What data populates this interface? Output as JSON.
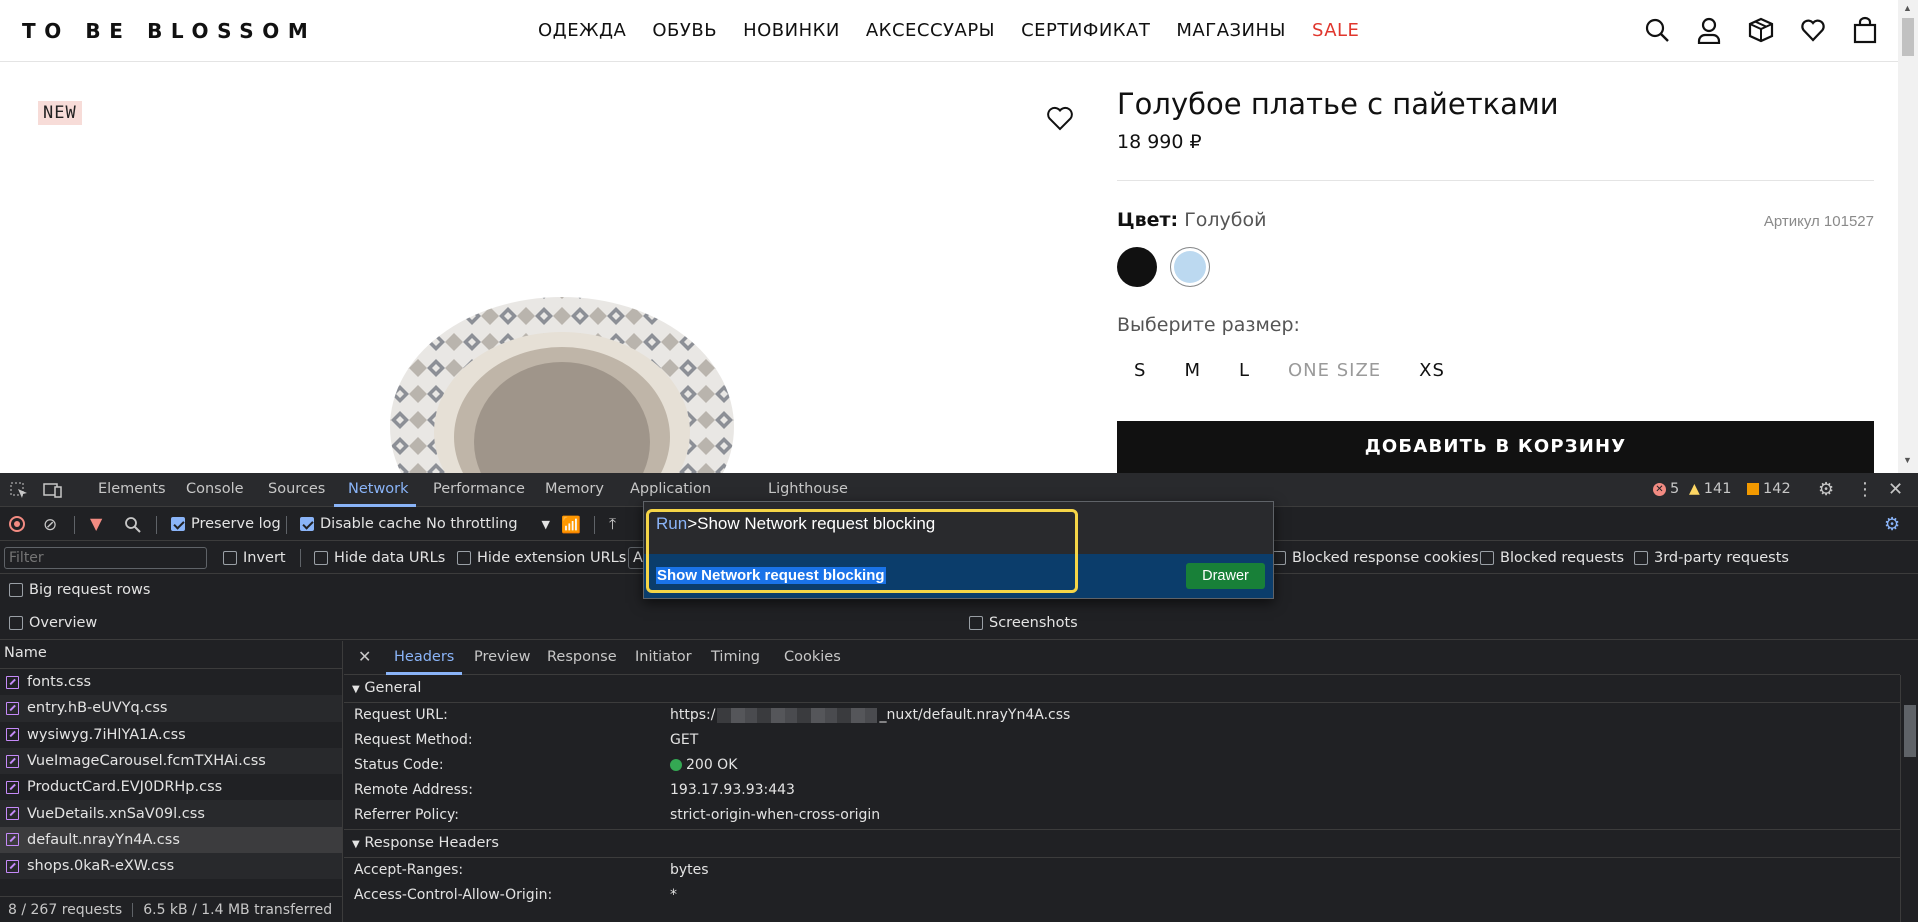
{
  "site": {
    "logo": "TO BE BLOSSOM",
    "nav": [
      {
        "label": "ОДЕЖДА"
      },
      {
        "label": "ОБУВЬ"
      },
      {
        "label": "НОВИНКИ"
      },
      {
        "label": "АКСЕССУАРЫ"
      },
      {
        "label": "СЕРТИФИКАТ"
      },
      {
        "label": "МАГАЗИНЫ"
      },
      {
        "label": "SALE"
      }
    ],
    "header_icons": [
      "search-icon",
      "user-icon",
      "box-icon",
      "heart-icon",
      "bag-icon"
    ]
  },
  "product": {
    "badge": "NEW",
    "title": "Голубое платье с пайетками",
    "price": "18 990 ₽",
    "color_label": "Цвет:",
    "color_value": "Голубой",
    "article": "Артикул 101527",
    "swatches": [
      {
        "color": "#111111"
      },
      {
        "color": "#bcd9f0",
        "selected": true
      }
    ],
    "size_label": "Выберите размер:",
    "sizes": [
      {
        "label": "S",
        "available": true
      },
      {
        "label": "M",
        "available": true
      },
      {
        "label": "L",
        "available": true
      },
      {
        "label": "ONE SIZE",
        "available": false
      },
      {
        "label": "XS",
        "available": true
      }
    ],
    "add_to_cart": "ДОБАВИТЬ В КОРЗИНУ"
  },
  "devtools": {
    "tabs": [
      "Elements",
      "Console",
      "Sources",
      "Network",
      "Performance",
      "Memory",
      "Application",
      "Lighthouse"
    ],
    "active_tab": "Network",
    "errors": "5",
    "warnings": "141",
    "issues": "142",
    "toolbar": {
      "preserve_log": "Preserve log",
      "disable_cache": "Disable cache",
      "throttling": "No throttling"
    },
    "filter": {
      "placeholder": "Filter",
      "invert": "Invert",
      "hide_data_urls": "Hide data URLs",
      "hide_extension_urls": "Hide extension URLs",
      "all_trunc": "A",
      "blocked_response_cookies": "Blocked response cookies",
      "blocked_requests": "Blocked requests",
      "third_party": "3rd-party requests"
    },
    "options": {
      "big_rows": "Big request rows",
      "overview": "Overview",
      "screenshots": "Screenshots"
    },
    "name_header": "Name",
    "requests": [
      "fonts.css",
      "entry.hB-eUVYq.css",
      "wysiwyg.7iHlYA1A.css",
      "VueImageCarousel.fcmTXHAi.css",
      "ProductCard.EVJ0DRHp.css",
      "VueDetails.xnSaV09l.css",
      "default.nrayYn4A.css",
      "shops.0kaR-eXW.css"
    ],
    "selected_request": "default.nrayYn4A.css",
    "status_requests": "8 / 267 requests",
    "status_transferred": "6.5 kB / 1.4 MB transferred",
    "detail_tabs": [
      "Headers",
      "Preview",
      "Response",
      "Initiator",
      "Timing",
      "Cookies"
    ],
    "general_title": "General",
    "general": [
      {
        "key": "Request URL:",
        "prefix": "https:/",
        "suffix": "_nuxt/default.nrayYn4A.css"
      },
      {
        "key": "Request Method:",
        "value": "GET"
      },
      {
        "key": "Status Code:",
        "value": "200 OK"
      },
      {
        "key": "Remote Address:",
        "value": "193.17.93.93:443"
      },
      {
        "key": "Referrer Policy:",
        "value": "strict-origin-when-cross-origin"
      }
    ],
    "response_headers_title": "Response Headers",
    "response_headers": [
      {
        "key": "Accept-Ranges:",
        "value": "bytes"
      },
      {
        "key": "Access-Control-Allow-Origin:",
        "value": "*"
      }
    ]
  },
  "command_menu": {
    "prefix": "Run",
    "query": ">Show Network request blocking",
    "item": "Show Network request blocking",
    "badge": "Drawer"
  }
}
